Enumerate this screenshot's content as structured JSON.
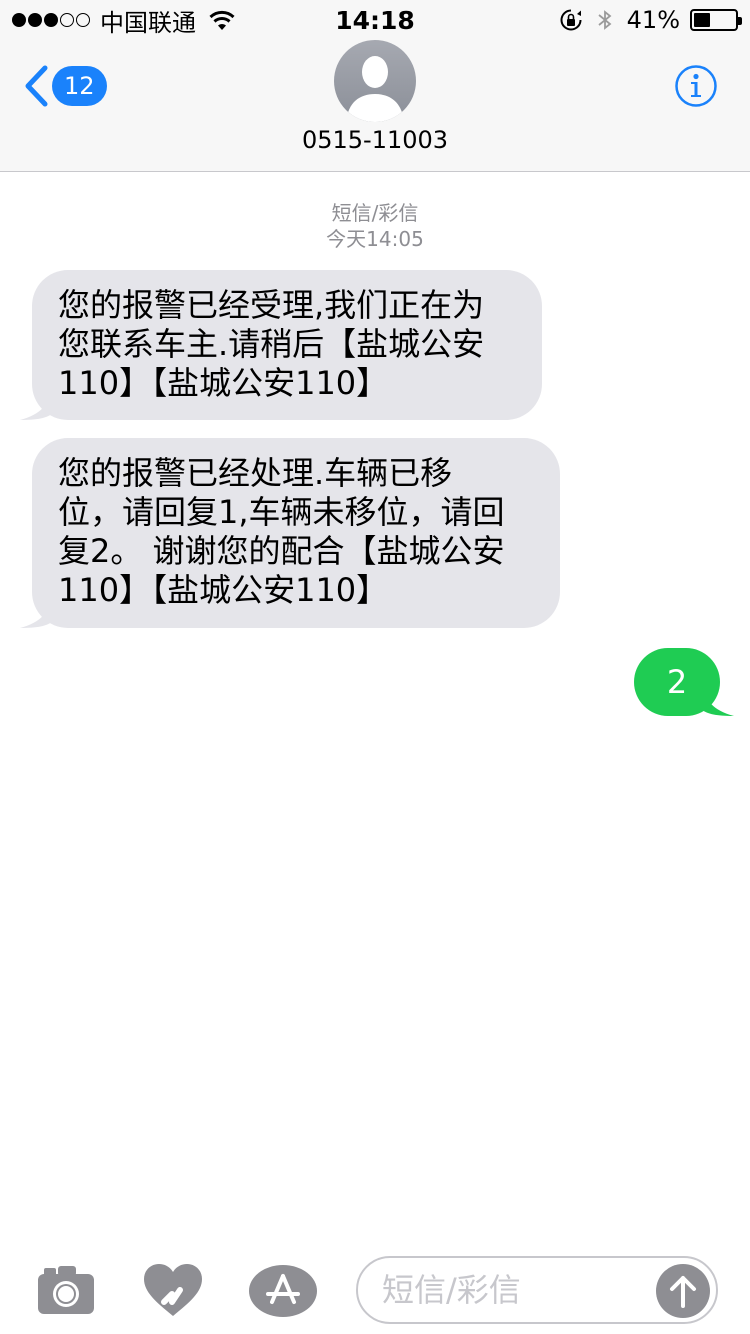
{
  "status_bar": {
    "carrier": "中国联通",
    "time": "14:18",
    "battery_percent": "41%",
    "battery_level": 0.41,
    "signal_bars_filled": 3,
    "signal_bars_total": 5
  },
  "header": {
    "back_badge": "12",
    "contact_name": "0515-11003",
    "icons": {
      "back": "chevron-left-icon",
      "info": "info-icon",
      "avatar": "person-icon"
    }
  },
  "thread": {
    "label": "短信/彩信",
    "timestamp": "今天14:05"
  },
  "messages": [
    {
      "direction": "incoming",
      "lines": [
        "您的报警已经受理,我们正在为",
        "您联系车主.请稍后【盐城公安",
        "110】【盐城公安110】"
      ]
    },
    {
      "direction": "incoming",
      "lines": [
        "您的报警已经处理.车辆已移",
        "位，请回复1,车辆未移位，请回",
        "复2。 谢谢您的配合【盐城公安",
        "110】【盐城公安110】"
      ]
    },
    {
      "direction": "outgoing",
      "text": "2"
    }
  ],
  "input_bar": {
    "placeholder": "短信/彩信",
    "icons": {
      "camera": "camera-icon",
      "digital_touch": "heart-icon",
      "apps": "app-store-icon",
      "send": "arrow-up-icon"
    }
  },
  "colors": {
    "accent": "#1a82fb",
    "incoming_bubble": "#e5e5ea",
    "outgoing_bubble": "#1fcc53",
    "icon_gray": "#8e8e93"
  }
}
